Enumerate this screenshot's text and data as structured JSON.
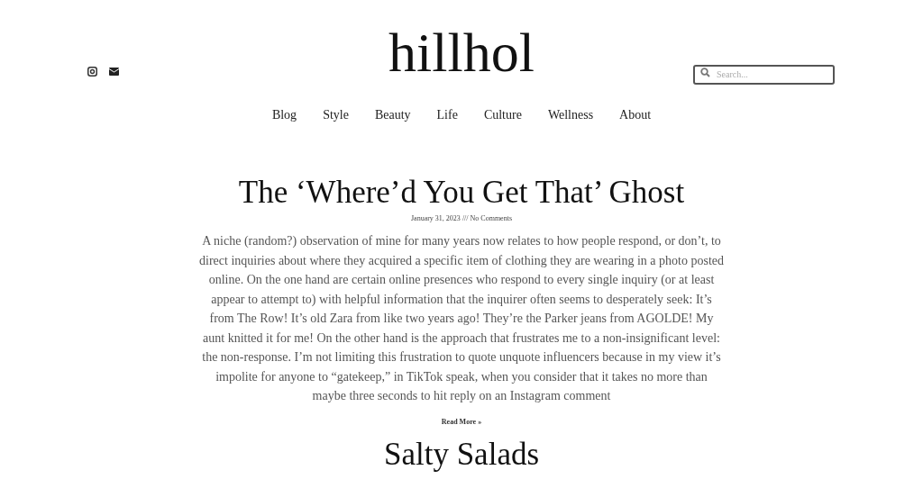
{
  "header": {
    "logo": "hillhol",
    "search": {
      "placeholder": "Search..."
    }
  },
  "nav": [
    {
      "label": "Blog"
    },
    {
      "label": "Style"
    },
    {
      "label": "Beauty"
    },
    {
      "label": "Life"
    },
    {
      "label": "Culture"
    },
    {
      "label": "Wellness"
    },
    {
      "label": "About"
    }
  ],
  "posts": [
    {
      "title": "The ‘Where’d You Get That’ Ghost",
      "date": "January 31, 2023",
      "separator": "///",
      "comments": "No Comments",
      "excerpt": "A niche (random?) observation of mine for many years now relates to how people respond, or don’t, to direct inquiries about where they acquired a specific item of clothing they are wearing in a photo posted online. On the one hand are certain online presences who respond to every single inquiry (or at least appear to attempt to) with helpful information that the inquirer often seems to desperately seek: It’s from The Row! It’s old Zara from like two years ago! They’re the Parker jeans from AGOLDE! My aunt knitted it for me! On the other hand is the approach that frustrates me to a non-insignificant level: the non-response. I’m not limiting this frustration to quote unquote influencers because in my view it’s impolite for anyone to “gatekeep,” in TikTok speak, when you consider that it takes no more than maybe three seconds to hit reply on an Instagram comment",
      "read_more": "Read More »"
    },
    {
      "title": "Salty Salads"
    }
  ]
}
